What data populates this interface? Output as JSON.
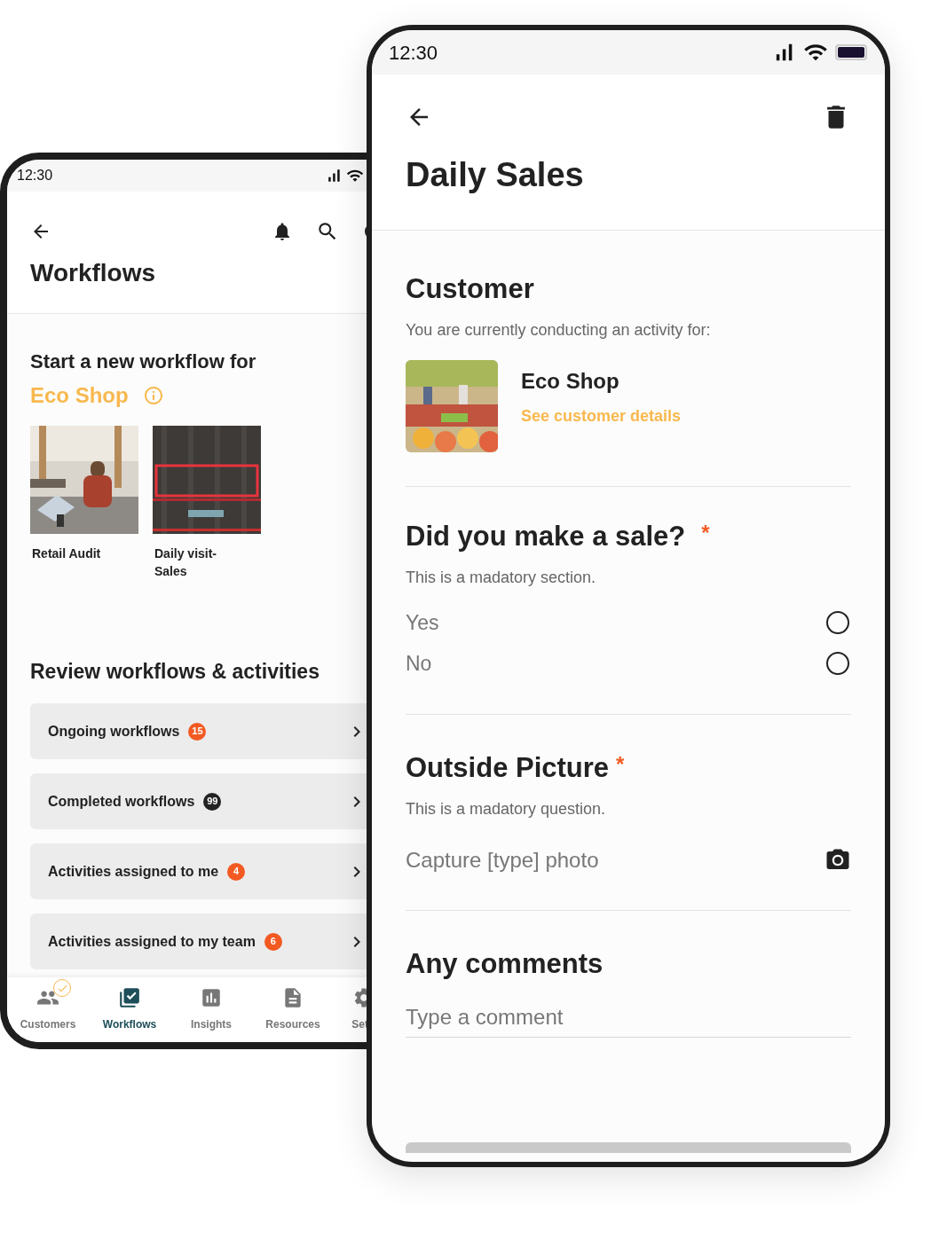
{
  "left_phone": {
    "status_bar": {
      "time": "12:30"
    },
    "title": "Workflows",
    "start": {
      "heading": "Start a new workflow for",
      "customer": "Eco Shop",
      "workflows": [
        {
          "label": "Retail Audit"
        },
        {
          "label": "Daily visit-Sales"
        }
      ]
    },
    "review": {
      "heading": "Review workflows & activities",
      "items": [
        {
          "label": "Ongoing workflows",
          "count": "15",
          "color": "#f25a22"
        },
        {
          "label": "Completed workflows",
          "count": "99",
          "color": "#222222"
        },
        {
          "label": "Activities assigned to me",
          "count": "4",
          "color": "#f25a22"
        },
        {
          "label": "Activities assigned to my team",
          "count": "6",
          "color": "#f25a22"
        }
      ]
    },
    "nav": [
      {
        "label": "Customers",
        "selected": false,
        "badge": true
      },
      {
        "label": "Workflows",
        "selected": true,
        "badge": false
      },
      {
        "label": "Insights",
        "selected": false,
        "badge": false
      },
      {
        "label": "Resources",
        "selected": false,
        "badge": false
      },
      {
        "label": "Set",
        "selected": false,
        "badge": false
      }
    ]
  },
  "right_phone": {
    "status_bar": {
      "time": "12:30"
    },
    "title": "Daily Sales",
    "customer": {
      "heading": "Customer",
      "subtitle": "You are currently conducting an activity for:",
      "name": "Eco Shop",
      "link": "See customer details"
    },
    "sale_question": {
      "heading": "Did you make a sale?",
      "required_mark": "*",
      "subtitle": "This is a madatory section.",
      "options": [
        {
          "label": "Yes",
          "selected": false
        },
        {
          "label": "No",
          "selected": false
        }
      ]
    },
    "picture_question": {
      "heading": "Outside Picture",
      "required_mark": "*",
      "subtitle": "This is a madatory question.",
      "action": "Capture [type] photo"
    },
    "comments": {
      "heading": "Any comments",
      "placeholder": "Type a comment"
    }
  }
}
